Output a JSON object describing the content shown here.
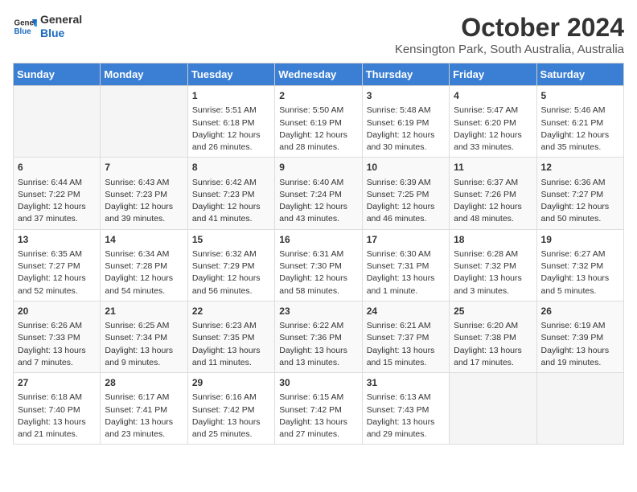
{
  "header": {
    "logo_line1": "General",
    "logo_line2": "Blue",
    "month": "October 2024",
    "location": "Kensington Park, South Australia, Australia"
  },
  "days_of_week": [
    "Sunday",
    "Monday",
    "Tuesday",
    "Wednesday",
    "Thursday",
    "Friday",
    "Saturday"
  ],
  "weeks": [
    [
      {
        "day": "",
        "content": ""
      },
      {
        "day": "",
        "content": ""
      },
      {
        "day": "1",
        "content": "Sunrise: 5:51 AM\nSunset: 6:18 PM\nDaylight: 12 hours and 26 minutes."
      },
      {
        "day": "2",
        "content": "Sunrise: 5:50 AM\nSunset: 6:19 PM\nDaylight: 12 hours and 28 minutes."
      },
      {
        "day": "3",
        "content": "Sunrise: 5:48 AM\nSunset: 6:19 PM\nDaylight: 12 hours and 30 minutes."
      },
      {
        "day": "4",
        "content": "Sunrise: 5:47 AM\nSunset: 6:20 PM\nDaylight: 12 hours and 33 minutes."
      },
      {
        "day": "5",
        "content": "Sunrise: 5:46 AM\nSunset: 6:21 PM\nDaylight: 12 hours and 35 minutes."
      }
    ],
    [
      {
        "day": "6",
        "content": "Sunrise: 6:44 AM\nSunset: 7:22 PM\nDaylight: 12 hours and 37 minutes."
      },
      {
        "day": "7",
        "content": "Sunrise: 6:43 AM\nSunset: 7:23 PM\nDaylight: 12 hours and 39 minutes."
      },
      {
        "day": "8",
        "content": "Sunrise: 6:42 AM\nSunset: 7:23 PM\nDaylight: 12 hours and 41 minutes."
      },
      {
        "day": "9",
        "content": "Sunrise: 6:40 AM\nSunset: 7:24 PM\nDaylight: 12 hours and 43 minutes."
      },
      {
        "day": "10",
        "content": "Sunrise: 6:39 AM\nSunset: 7:25 PM\nDaylight: 12 hours and 46 minutes."
      },
      {
        "day": "11",
        "content": "Sunrise: 6:37 AM\nSunset: 7:26 PM\nDaylight: 12 hours and 48 minutes."
      },
      {
        "day": "12",
        "content": "Sunrise: 6:36 AM\nSunset: 7:27 PM\nDaylight: 12 hours and 50 minutes."
      }
    ],
    [
      {
        "day": "13",
        "content": "Sunrise: 6:35 AM\nSunset: 7:27 PM\nDaylight: 12 hours and 52 minutes."
      },
      {
        "day": "14",
        "content": "Sunrise: 6:34 AM\nSunset: 7:28 PM\nDaylight: 12 hours and 54 minutes."
      },
      {
        "day": "15",
        "content": "Sunrise: 6:32 AM\nSunset: 7:29 PM\nDaylight: 12 hours and 56 minutes."
      },
      {
        "day": "16",
        "content": "Sunrise: 6:31 AM\nSunset: 7:30 PM\nDaylight: 12 hours and 58 minutes."
      },
      {
        "day": "17",
        "content": "Sunrise: 6:30 AM\nSunset: 7:31 PM\nDaylight: 13 hours and 1 minute."
      },
      {
        "day": "18",
        "content": "Sunrise: 6:28 AM\nSunset: 7:32 PM\nDaylight: 13 hours and 3 minutes."
      },
      {
        "day": "19",
        "content": "Sunrise: 6:27 AM\nSunset: 7:32 PM\nDaylight: 13 hours and 5 minutes."
      }
    ],
    [
      {
        "day": "20",
        "content": "Sunrise: 6:26 AM\nSunset: 7:33 PM\nDaylight: 13 hours and 7 minutes."
      },
      {
        "day": "21",
        "content": "Sunrise: 6:25 AM\nSunset: 7:34 PM\nDaylight: 13 hours and 9 minutes."
      },
      {
        "day": "22",
        "content": "Sunrise: 6:23 AM\nSunset: 7:35 PM\nDaylight: 13 hours and 11 minutes."
      },
      {
        "day": "23",
        "content": "Sunrise: 6:22 AM\nSunset: 7:36 PM\nDaylight: 13 hours and 13 minutes."
      },
      {
        "day": "24",
        "content": "Sunrise: 6:21 AM\nSunset: 7:37 PM\nDaylight: 13 hours and 15 minutes."
      },
      {
        "day": "25",
        "content": "Sunrise: 6:20 AM\nSunset: 7:38 PM\nDaylight: 13 hours and 17 minutes."
      },
      {
        "day": "26",
        "content": "Sunrise: 6:19 AM\nSunset: 7:39 PM\nDaylight: 13 hours and 19 minutes."
      }
    ],
    [
      {
        "day": "27",
        "content": "Sunrise: 6:18 AM\nSunset: 7:40 PM\nDaylight: 13 hours and 21 minutes."
      },
      {
        "day": "28",
        "content": "Sunrise: 6:17 AM\nSunset: 7:41 PM\nDaylight: 13 hours and 23 minutes."
      },
      {
        "day": "29",
        "content": "Sunrise: 6:16 AM\nSunset: 7:42 PM\nDaylight: 13 hours and 25 minutes."
      },
      {
        "day": "30",
        "content": "Sunrise: 6:15 AM\nSunset: 7:42 PM\nDaylight: 13 hours and 27 minutes."
      },
      {
        "day": "31",
        "content": "Sunrise: 6:13 AM\nSunset: 7:43 PM\nDaylight: 13 hours and 29 minutes."
      },
      {
        "day": "",
        "content": ""
      },
      {
        "day": "",
        "content": ""
      }
    ]
  ]
}
